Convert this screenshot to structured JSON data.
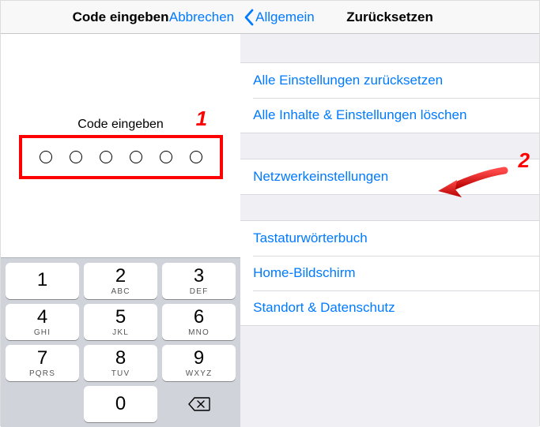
{
  "left": {
    "header_title": "Code eingeben",
    "cancel": "Abbrechen",
    "prompt": "Code eingeben",
    "annotation1": "1",
    "keypad": {
      "k1_num": "1",
      "k1_let": "",
      "k2_num": "2",
      "k2_let": "ABC",
      "k3_num": "3",
      "k3_let": "DEF",
      "k4_num": "4",
      "k4_let": "GHI",
      "k5_num": "5",
      "k5_let": "JKL",
      "k6_num": "6",
      "k6_let": "MNO",
      "k7_num": "7",
      "k7_let": "PQRS",
      "k8_num": "8",
      "k8_let": "TUV",
      "k9_num": "9",
      "k9_let": "WXYZ",
      "k0_num": "0"
    }
  },
  "right": {
    "back_label": "Allgemein",
    "title": "Zurücksetzen",
    "annotation2": "2",
    "rows": {
      "r1": "Alle Einstellungen zurücksetzen",
      "r2": "Alle Inhalte & Einstellungen löschen",
      "r3": "Netzwerkeinstellungen",
      "r4": "Tastaturwörterbuch",
      "r5": "Home-Bildschirm",
      "r6": "Standort & Datenschutz"
    }
  }
}
